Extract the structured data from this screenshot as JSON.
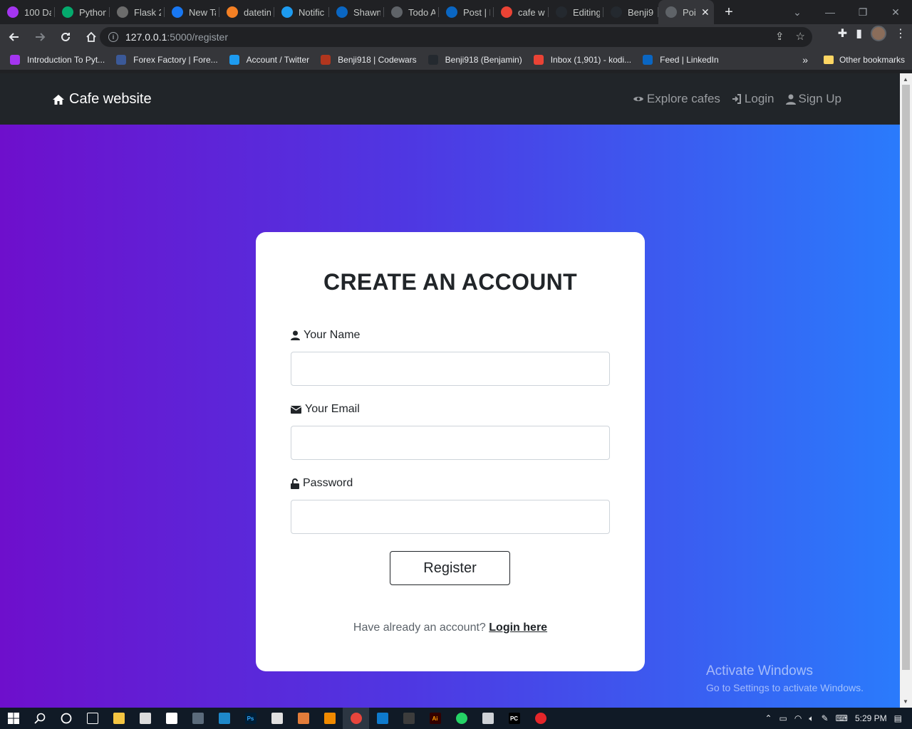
{
  "browser": {
    "tabs": [
      {
        "title": "100 Da",
        "icon": "udemy-icon",
        "color": "#a435f0"
      },
      {
        "title": "Python",
        "icon": "w3-icon",
        "color": "#04aa6d"
      },
      {
        "title": "Flask 2",
        "icon": "flask-icon",
        "color": "#6c6c6c"
      },
      {
        "title": "New Ta",
        "icon": "meta-icon",
        "color": "#1877f2"
      },
      {
        "title": "datetin",
        "icon": "stackoverflow-icon",
        "color": "#f48024"
      },
      {
        "title": "Notific",
        "icon": "twitter-icon",
        "color": "#1d9bf0"
      },
      {
        "title": "Shawn",
        "icon": "linkedin-icon",
        "color": "#0a66c2"
      },
      {
        "title": "Todo A",
        "icon": "globe-icon",
        "color": "#5f6368"
      },
      {
        "title": "Post | F",
        "icon": "linkedin-icon",
        "color": "#0a66c2"
      },
      {
        "title": "cafe wi",
        "icon": "google-icon",
        "color": "#ea4335"
      },
      {
        "title": "Editing",
        "icon": "github-icon",
        "color": "#24292f"
      },
      {
        "title": "Benji9",
        "icon": "github-icon",
        "color": "#24292f"
      },
      {
        "title": "Poi",
        "icon": "globe-icon",
        "color": "#5f6368",
        "active": true
      }
    ],
    "new_tab": "+",
    "window_controls": [
      "⌄",
      "—",
      "❐",
      "✕"
    ],
    "url_host": "127.0.0.1",
    "url_path": ":5000/register",
    "bookmarks": [
      {
        "label": "Introduction To Pyt...",
        "icon": "udemy-icon",
        "color": "#a435f0"
      },
      {
        "label": "Forex Factory | Fore...",
        "icon": "forex-icon",
        "color": "#3b5998"
      },
      {
        "label": "Account / Twitter",
        "icon": "twitter-icon",
        "color": "#1d9bf0"
      },
      {
        "label": "Benji918 | Codewars",
        "icon": "codewars-icon",
        "color": "#b1361e"
      },
      {
        "label": "Benji918 (Benjamin)",
        "icon": "github-icon",
        "color": "#24292f"
      },
      {
        "label": "Inbox (1,901) - kodi...",
        "icon": "gmail-icon",
        "color": "#ea4335"
      },
      {
        "label": "Feed | LinkedIn",
        "icon": "linkedin-icon",
        "color": "#0a66c2"
      }
    ],
    "bookmarks_overflow": "»",
    "other_bookmarks": "Other bookmarks"
  },
  "site": {
    "brand": "Cafe website",
    "nav": [
      {
        "label": "Explore cafes",
        "icon": "eye-icon"
      },
      {
        "label": "Login",
        "icon": "sign-in-icon"
      },
      {
        "label": "Sign Up",
        "icon": "user-icon"
      }
    ]
  },
  "form": {
    "title": "CREATE AN ACCOUNT",
    "name_label": "Your Name",
    "name_value": "",
    "email_label": "Your Email",
    "email_value": "",
    "password_label": "Password",
    "password_value": "",
    "submit_label": "Register",
    "login_prompt": "Have already an account?",
    "login_link": "Login here"
  },
  "watermark": {
    "line1": "Activate Windows",
    "line2": "Go to Settings to activate Windows."
  },
  "taskbar": {
    "time": "5:29 PM"
  },
  "colors": {
    "gradient_start": "#6e0fcc",
    "gradient_end": "#2a7bfc",
    "navbar": "#212529"
  }
}
